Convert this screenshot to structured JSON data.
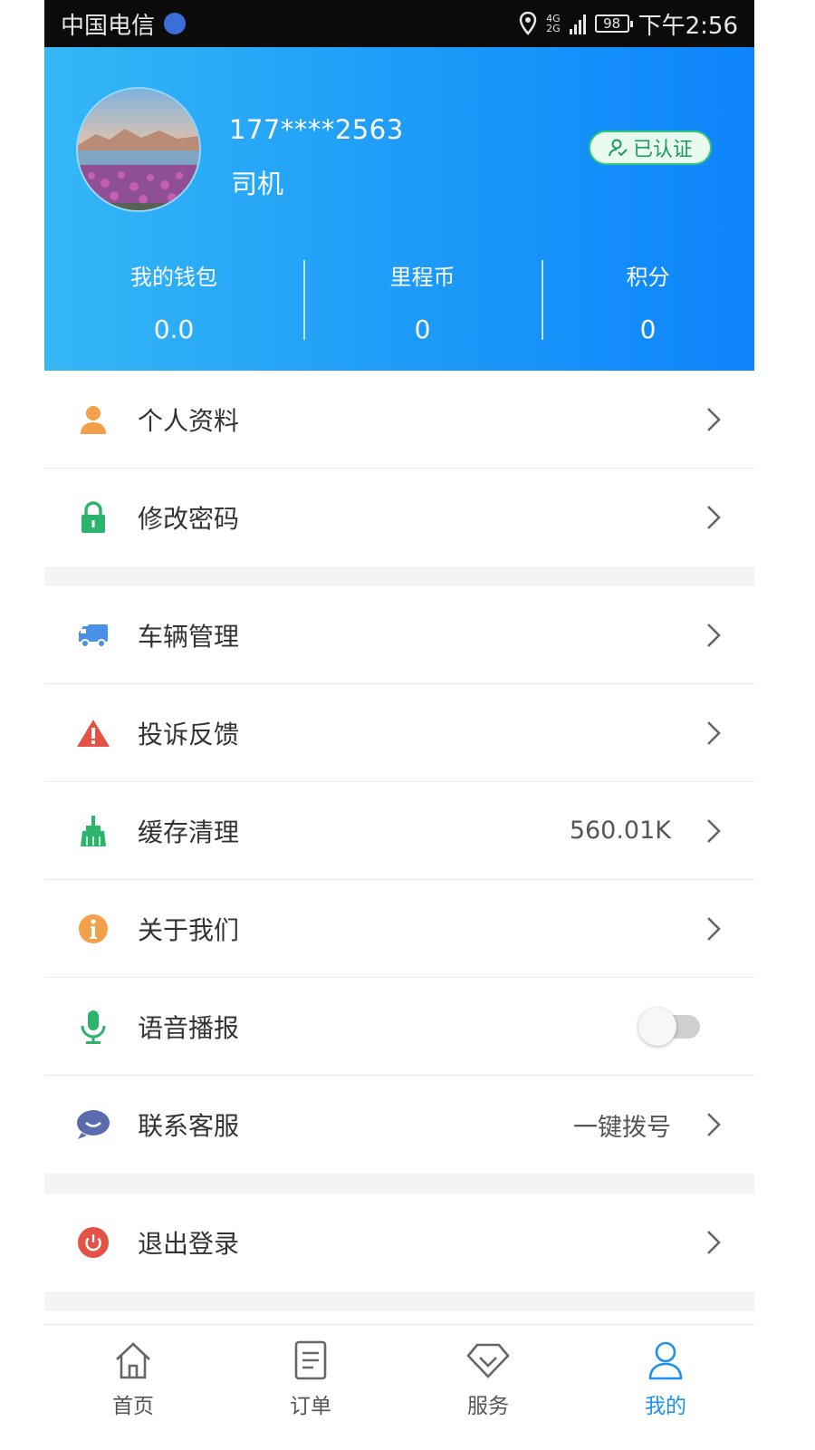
{
  "status_bar": {
    "carrier": "中国电信",
    "network_top": "4G",
    "network_bottom": "2G",
    "battery": "98",
    "time": "下午2:56"
  },
  "profile": {
    "phone": "177****2563",
    "role": "司机",
    "verified_label": "已认证"
  },
  "stats": [
    {
      "label": "我的钱包",
      "value": "0.0"
    },
    {
      "label": "里程币",
      "value": "0"
    },
    {
      "label": "积分",
      "value": "0"
    }
  ],
  "menu": {
    "group1": [
      {
        "label": "个人资料",
        "icon": "person-icon"
      },
      {
        "label": "修改密码",
        "icon": "lock-icon"
      }
    ],
    "group2": [
      {
        "label": "车辆管理",
        "icon": "truck-icon"
      },
      {
        "label": "投诉反馈",
        "icon": "warning-icon"
      },
      {
        "label": "缓存清理",
        "icon": "broom-icon",
        "value": "560.01K"
      },
      {
        "label": "关于我们",
        "icon": "info-icon"
      },
      {
        "label": "语音播报",
        "icon": "microphone-icon",
        "toggle": false
      },
      {
        "label": "联系客服",
        "icon": "chat-icon",
        "value": "一键拨号"
      }
    ],
    "group3": [
      {
        "label": "退出登录",
        "icon": "power-icon"
      }
    ]
  },
  "tabs": [
    {
      "label": "首页",
      "icon": "home-icon"
    },
    {
      "label": "订单",
      "icon": "order-icon"
    },
    {
      "label": "服务",
      "icon": "diamond-icon"
    },
    {
      "label": "我的",
      "icon": "user-icon",
      "active": true
    }
  ],
  "colors": {
    "header_start": "#35b7f6",
    "header_end": "#0d84fb",
    "accent": "#1e90f2",
    "verified_green": "#35c97a"
  }
}
